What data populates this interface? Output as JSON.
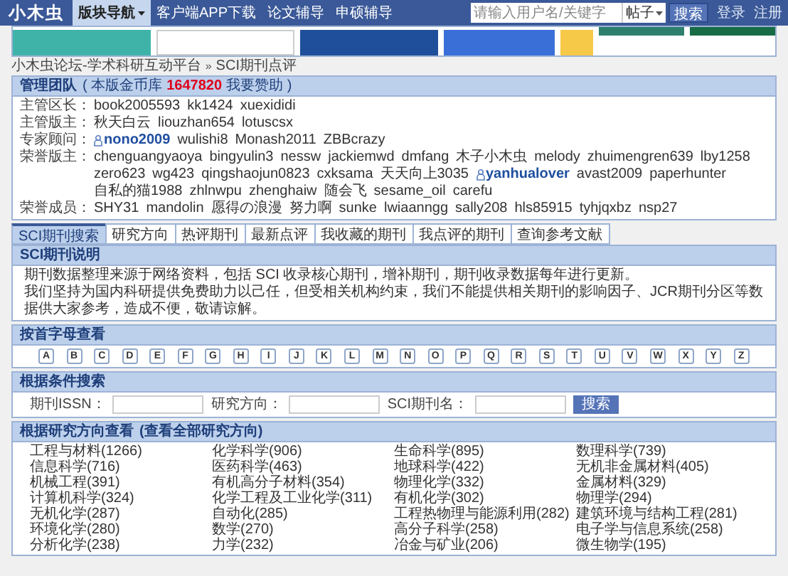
{
  "nav": {
    "logo": "小木虫",
    "items": [
      {
        "label": "版块导航",
        "selected": true,
        "dropdown": true
      },
      {
        "label": "客户端APP下载",
        "selected": false,
        "dropdown": false
      },
      {
        "label": "论文辅导",
        "selected": false,
        "dropdown": false
      },
      {
        "label": "申硕辅导",
        "selected": false,
        "dropdown": false
      }
    ],
    "search_placeholder": "请输入用户名/关键字",
    "search_scope": "帖子",
    "search_button": "搜索",
    "links": [
      "登录",
      "注册"
    ]
  },
  "breadcrumb": {
    "items": [
      "小木虫论坛-学术科研互动平台",
      "SCI期刊点评"
    ],
    "separator": "»"
  },
  "management": {
    "title": "管理团队",
    "note_before": "( 本版金币库",
    "amount": "1647820",
    "note_after": "我要赞助 )",
    "rows": [
      {
        "label": "主管区长：",
        "members": [
          {
            "name": "book2005593",
            "highlighted": false
          },
          {
            "name": "kk1424",
            "highlighted": false
          },
          {
            "name": "xuexididi",
            "highlighted": false
          }
        ]
      },
      {
        "label": "主管版主：",
        "members": [
          {
            "name": "秋天白云",
            "highlighted": false
          },
          {
            "name": "liouzhan654",
            "highlighted": false
          },
          {
            "name": "lotuscsx",
            "highlighted": false
          }
        ]
      },
      {
        "label": "专家顾问：",
        "members": [
          {
            "name": "nono2009",
            "highlighted": true
          },
          {
            "name": "wulishi8",
            "highlighted": false
          },
          {
            "name": "Monash2011",
            "highlighted": false
          },
          {
            "name": "ZBBcrazy",
            "highlighted": false
          }
        ]
      },
      {
        "label": "荣誉版主：",
        "members": [
          {
            "name": "chenguangyaoya",
            "highlighted": false
          },
          {
            "name": "bingyulin3",
            "highlighted": false
          },
          {
            "name": "nessw",
            "highlighted": false
          },
          {
            "name": "jackiemwd",
            "highlighted": false
          },
          {
            "name": "dmfang",
            "highlighted": false
          },
          {
            "name": "木子小木虫",
            "highlighted": false
          },
          {
            "name": "melody",
            "highlighted": false
          },
          {
            "name": "zhuimengren639",
            "highlighted": false
          },
          {
            "name": "lby1258",
            "highlighted": false
          },
          {
            "name": "zero623",
            "highlighted": false
          },
          {
            "name": "wg423",
            "highlighted": false
          },
          {
            "name": "qingshaojun0823",
            "highlighted": false
          },
          {
            "name": "cxksama",
            "highlighted": false
          },
          {
            "name": "天天向上3035",
            "highlighted": false
          },
          {
            "name": "yanhualover",
            "highlighted": true
          },
          {
            "name": "avast2009",
            "highlighted": false
          },
          {
            "name": "paperhunter",
            "highlighted": false
          },
          {
            "name": "自私的猫1988",
            "highlighted": false
          },
          {
            "name": "zhlnwpu",
            "highlighted": false
          },
          {
            "name": "zhenghaiw",
            "highlighted": false
          },
          {
            "name": "随会飞",
            "highlighted": false
          },
          {
            "name": "sesame_oil",
            "highlighted": false
          },
          {
            "name": "carefu",
            "highlighted": false
          }
        ]
      },
      {
        "label": "荣誉成员：",
        "members": [
          {
            "name": "SHY31",
            "highlighted": false
          },
          {
            "name": "mandolin",
            "highlighted": false
          },
          {
            "name": "愿得の浪漫",
            "highlighted": false
          },
          {
            "name": "努力啊",
            "highlighted": false
          },
          {
            "name": "sunke",
            "highlighted": false
          },
          {
            "name": "lwiaanngg",
            "highlighted": false
          },
          {
            "name": "sally208",
            "highlighted": false
          },
          {
            "name": "hls85915",
            "highlighted": false
          },
          {
            "name": "tyhjqxbz",
            "highlighted": false
          },
          {
            "name": "nsp27",
            "highlighted": false
          }
        ]
      }
    ]
  },
  "tabs": [
    {
      "label": "SCI期刊搜索",
      "selected": true
    },
    {
      "label": "研究方向",
      "selected": false
    },
    {
      "label": "热评期刊",
      "selected": false
    },
    {
      "label": "最新点评",
      "selected": false
    },
    {
      "label": "我收藏的期刊",
      "selected": false
    },
    {
      "label": "我点评的期刊",
      "selected": false
    },
    {
      "label": "查询参考文献",
      "selected": false
    }
  ],
  "description": {
    "title": "SCI期刊说明",
    "paragraphs": [
      "期刊数据整理来源于网络资料，包括 SCI 收录核心期刊，增补期刊，期刊收录数据每年进行更新。",
      "我们坚持为国内科研提供免费助力以己任，但受相关机构约束，我们不能提供相关期刊的影响因子、JCR期刊分区等数据供大家参考，造成不便，敬请谅解。"
    ]
  },
  "letters": {
    "title": "按首字母查看",
    "items": [
      "A",
      "B",
      "C",
      "D",
      "E",
      "F",
      "G",
      "H",
      "I",
      "J",
      "K",
      "L",
      "M",
      "N",
      "O",
      "P",
      "Q",
      "R",
      "S",
      "T",
      "U",
      "V",
      "W",
      "X",
      "Y",
      "Z"
    ]
  },
  "search": {
    "title": "根据条件搜索",
    "fields": [
      {
        "label": "期刊ISSN："
      },
      {
        "label": "研究方向："
      },
      {
        "label": "SCI期刊名："
      }
    ],
    "button": "搜索"
  },
  "categories": {
    "title": "根据研究方向查看",
    "link": "(查看全部研究方向)",
    "items": [
      "工程与材料(1266)",
      "化学科学(906)",
      "生命科学(895)",
      "数理科学(739)",
      "信息科学(716)",
      "医药科学(463)",
      "地球科学(422)",
      "无机非金属材料(405)",
      "机械工程(391)",
      "有机高分子材料(354)",
      "物理化学(332)",
      "金属材料(329)",
      "计算机科学(324)",
      "化学工程及工业化学(311)",
      "有机化学(302)",
      "物理学(294)",
      "无机化学(287)",
      "自动化(285)",
      "工程热物理与能源利用(282)",
      "建筑环境与结构工程(281)",
      "环境化学(280)",
      "数学(270)",
      "高分子科学(258)",
      "电子学与信息系统(258)",
      "分析化学(238)",
      "力学(232)",
      "冶金与矿业(206)",
      "微生物学(195)"
    ]
  }
}
